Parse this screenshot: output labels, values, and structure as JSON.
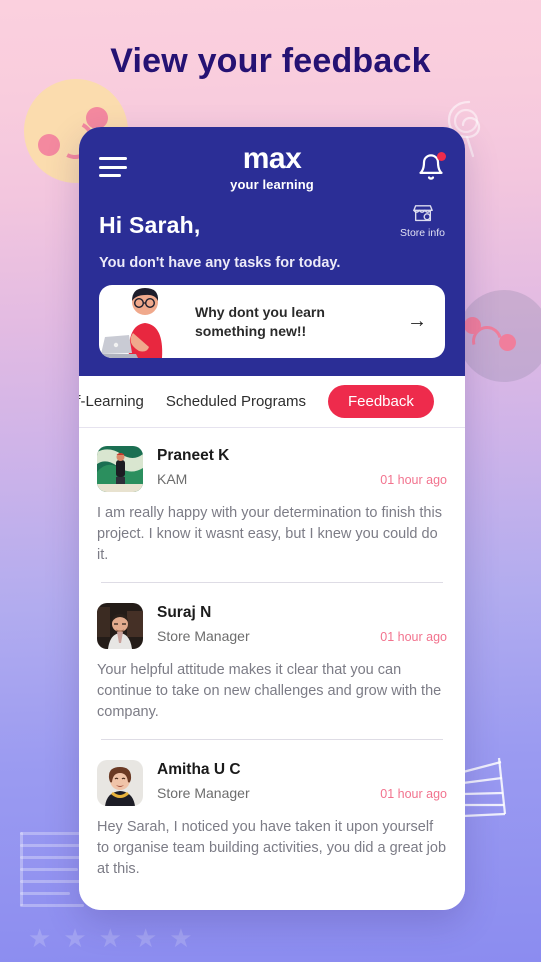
{
  "page": {
    "title": "View your feedback",
    "title_color": "#251273",
    "bg_top_color": "#fbd0de",
    "bg_bottom_color": "#8b8cf0"
  },
  "decor": {
    "happy_face": "smiley-face-happy",
    "sad_face": "smiley-face-sad",
    "spiral": "spiral-icon",
    "ladder": "ladder-icon",
    "stars": [
      "★",
      "★",
      "★",
      "★",
      "★"
    ]
  },
  "app": {
    "header": {
      "menu_icon": "hamburger-menu-icon",
      "brand_word": "max",
      "brand_tagline": "your learning",
      "bell_icon": "notification-bell-icon",
      "bell_has_badge": true,
      "store_icon": "storefront-icon",
      "store_label": "Store info",
      "greeting": "Hi Sarah,",
      "tasks_line": "You don't have any tasks for today.",
      "accent_navy": "#2b2e96"
    },
    "promo": {
      "illustration": "person-with-laptop-illustration",
      "text": "Why dont you learn something new!!",
      "arrow_icon": "arrow-right-icon"
    },
    "tabs": [
      {
        "label": "lf-Learning",
        "active": false
      },
      {
        "label": "Scheduled Programs",
        "active": false
      },
      {
        "label": "Feedback",
        "active": true
      }
    ],
    "tab_active_color": "#ee2b4c",
    "feedback": [
      {
        "avatar": "avatar-praneet-k",
        "name": "Praneet K",
        "role": "KAM",
        "time": "01 hour ago",
        "message": "I am really happy with your determination to finish this project. I know it wasnt easy, but I knew you could do it."
      },
      {
        "avatar": "avatar-suraj-n",
        "name": "Suraj N",
        "role": "Store Manager",
        "time": "01 hour ago",
        "message": "Your helpful attitude makes it clear that you can continue to take on new challenges and grow with the company."
      },
      {
        "avatar": "avatar-amitha-u-c",
        "name": "Amitha U C",
        "role": "Store Manager",
        "time": "01 hour ago",
        "message": "Hey Sarah, I noticed you have taken it upon yourself to organise team building activities, you did a great job at this."
      }
    ]
  }
}
